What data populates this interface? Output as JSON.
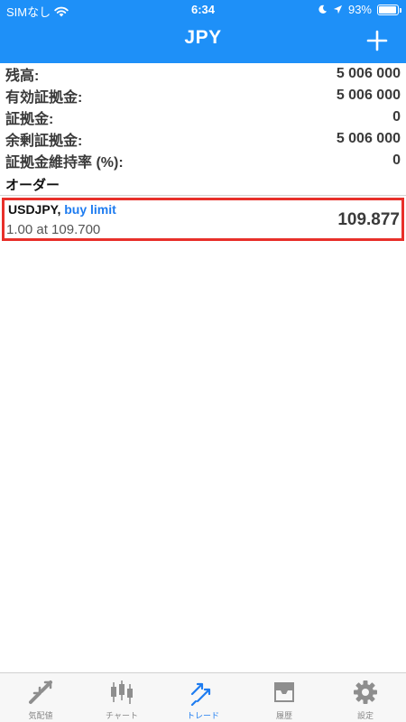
{
  "status_bar": {
    "carrier": "SIMなし",
    "time": "6:34",
    "battery": "93%",
    "battery_level": 0.93
  },
  "nav": {
    "title": "JPY",
    "add_icon": "plus-icon"
  },
  "account": [
    {
      "label": "残高:",
      "value": "5 006 000"
    },
    {
      "label": "有効証拠金:",
      "value": "5 006 000"
    },
    {
      "label": "証拠金:",
      "value": "0"
    },
    {
      "label": "余剰証拠金:",
      "value": "5 006 000"
    },
    {
      "label": "証拠金維持率 (%):",
      "value": "0"
    }
  ],
  "orders_section": {
    "title": "オーダー"
  },
  "orders": [
    {
      "symbol": "USDJPY,",
      "type": "buy limit",
      "details": "1.00 at 109.700",
      "current_price": "109.877"
    }
  ],
  "tabs": [
    {
      "label": "気配値",
      "icon": "quotes-icon",
      "active": false
    },
    {
      "label": "チャート",
      "icon": "chart-icon",
      "active": false
    },
    {
      "label": "トレード",
      "icon": "trade-icon",
      "active": true
    },
    {
      "label": "履歴",
      "icon": "history-icon",
      "active": false
    },
    {
      "label": "設定",
      "icon": "settings-icon",
      "active": false
    }
  ],
  "colors": {
    "header": "#1E90F8",
    "accent": "#1E7CF0",
    "highlight_border": "#E8302A"
  }
}
